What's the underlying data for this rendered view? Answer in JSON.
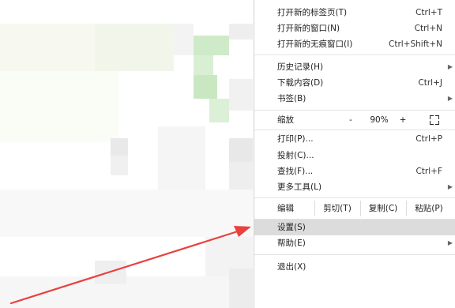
{
  "menu": {
    "items_top": [
      {
        "label": "打开新的标签页(T)",
        "shortcut": "Ctrl+T"
      },
      {
        "label": "打开新的窗口(N)",
        "shortcut": "Ctrl+N"
      },
      {
        "label": "打开新的无痕窗口(I)",
        "shortcut": "Ctrl+Shift+N"
      }
    ],
    "items_mid": [
      {
        "label": "历史记录(H)",
        "shortcut": ""
      },
      {
        "label": "下载内容(D)",
        "shortcut": "Ctrl+J"
      },
      {
        "label": "书签(B)",
        "shortcut": ""
      }
    ],
    "zoom": {
      "label": "缩放",
      "minus": "-",
      "value": "90%",
      "plus": "+"
    },
    "items_tools": [
      {
        "label": "打印(P)...",
        "shortcut": "Ctrl+P"
      },
      {
        "label": "投射(C)...",
        "shortcut": ""
      },
      {
        "label": "查找(F)...",
        "shortcut": "Ctrl+F"
      },
      {
        "label": "更多工具(L)",
        "shortcut": ""
      }
    ],
    "edit": {
      "label": "编辑",
      "cut": "剪切(T)",
      "copy": "复制(C)",
      "paste": "粘贴(P)"
    },
    "settings": "设置(S)",
    "help": "帮助(E)",
    "exit": "退出(X)",
    "submenu_arrow": "▶"
  },
  "colors": {
    "highlight": "#dcdcdc",
    "arrow": "#e8413f",
    "blur_green": "#bfe5b8"
  }
}
